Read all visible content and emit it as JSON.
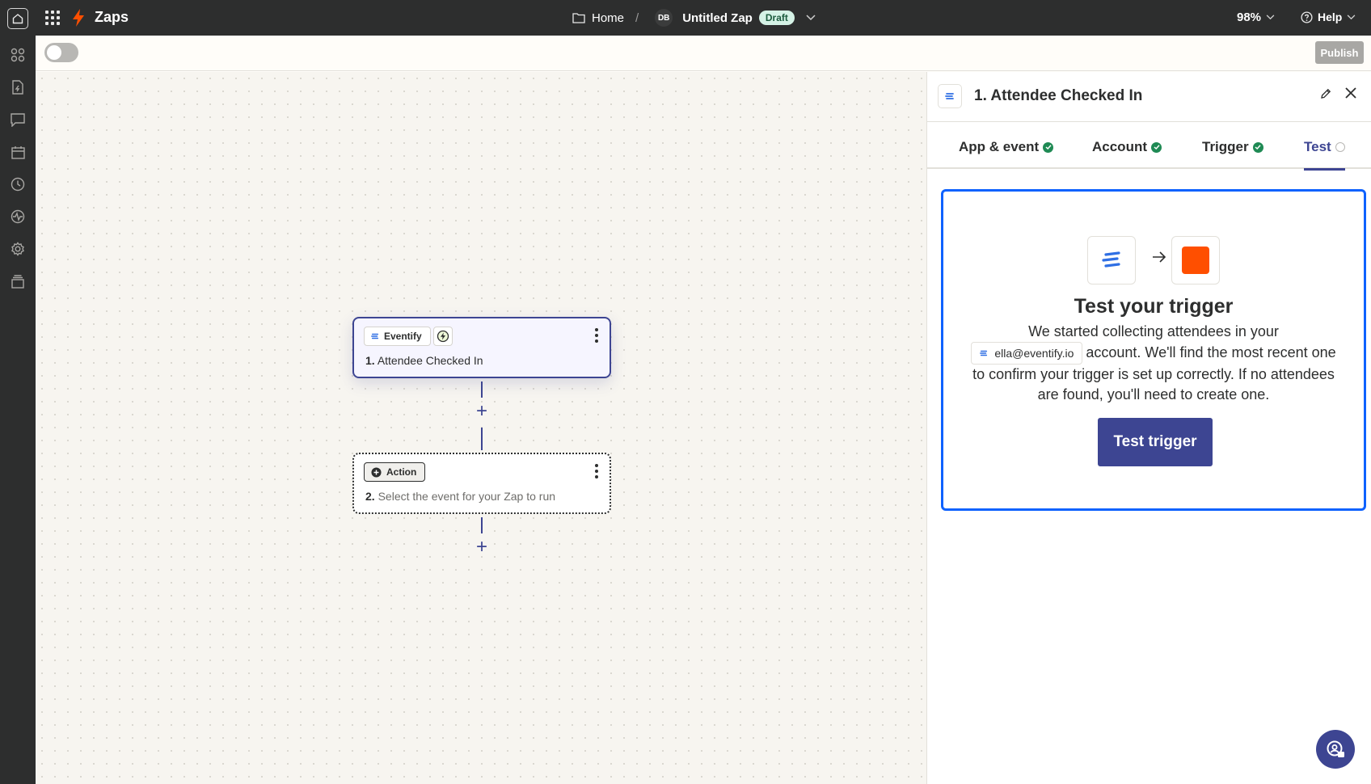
{
  "topbar": {
    "app_name": "Zaps",
    "breadcrumb_home": "Home",
    "breadcrumb_sep": "/",
    "avatar_initials": "DB",
    "zap_name": "Untitled Zap",
    "status_badge": "Draft",
    "zoom": "98%",
    "help_label": "Help"
  },
  "subbar": {
    "publish_label": "Publish",
    "toggle_on": false
  },
  "canvas": {
    "trigger_node": {
      "app_label": "Eventify",
      "step_number": "1.",
      "step_title": "Attendee Checked In"
    },
    "action_node": {
      "chip_label": "Action",
      "step_number": "2.",
      "step_placeholder": "Select the event for your Zap to run"
    }
  },
  "panel": {
    "title": "1. Attendee Checked In",
    "tabs": [
      {
        "label": "App & event",
        "status": "complete"
      },
      {
        "label": "Account",
        "status": "complete"
      },
      {
        "label": "Trigger",
        "status": "complete"
      },
      {
        "label": "Test",
        "status": "pending"
      }
    ],
    "test_card": {
      "heading": "Test your trigger",
      "body_line1": "We started collecting attendees in your",
      "account_email": "ella@eventify.io",
      "body_line2": "account. We'll find the most recent one to confirm your trigger is set up correctly. If no attendees are found, you'll need to create one.",
      "button_label": "Test trigger"
    }
  },
  "colors": {
    "topbar_bg": "#2d2e2e",
    "accent": "#3d4592",
    "brand_orange": "#ff4f00",
    "card_border": "#0f62fe",
    "success": "#1f8a54",
    "draft_badge_bg": "#d5f2e6"
  },
  "icons": {
    "rail": [
      "apps-icon",
      "zap-file-icon",
      "chat-icon",
      "calendar-icon",
      "history-icon",
      "activity-icon",
      "settings-icon",
      "archive-icon"
    ],
    "copilot": "sparkle-icon",
    "support": "support-chat-icon"
  }
}
